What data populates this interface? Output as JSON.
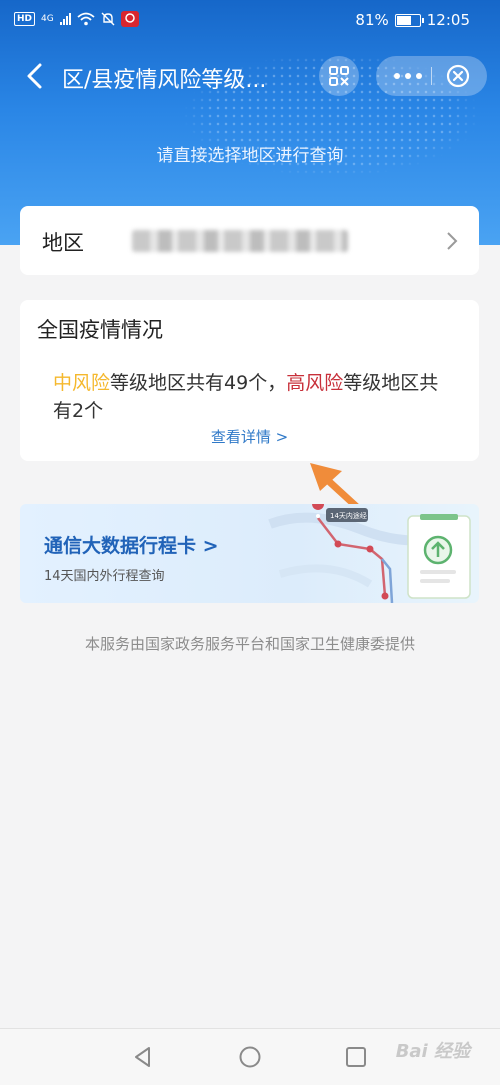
{
  "status_bar": {
    "hd": "HD",
    "network": "4G",
    "battery_percent": "81%",
    "battery_level": 0.81,
    "time": "12:05"
  },
  "nav": {
    "title": "区/县疫情风险等级..."
  },
  "hero": {
    "subtitle": "请直接选择地区进行查询"
  },
  "region_card": {
    "label": "地区"
  },
  "national": {
    "title": "全国疫情情况",
    "medium_risk": "中风险",
    "mid_text": "等级地区共有49个，",
    "high_risk": "高风险",
    "high_text": "等级地区共有2个",
    "detail_link": "查看详情 >"
  },
  "banner": {
    "title": "通信大数据行程卡 >",
    "subtitle": "14天国内外行程查询",
    "map_label": "14天内途经"
  },
  "footer": {
    "text": "本服务由国家政务服务平台和国家卫生健康委提供"
  },
  "watermark": {
    "text": "Bai 经验"
  },
  "colors": {
    "accent_blue": "#2a86e6",
    "medium_risk": "#f5b82d",
    "high_risk": "#c8303a",
    "link": "#2f79c8",
    "annotation_arrow": "#f08c3a"
  }
}
